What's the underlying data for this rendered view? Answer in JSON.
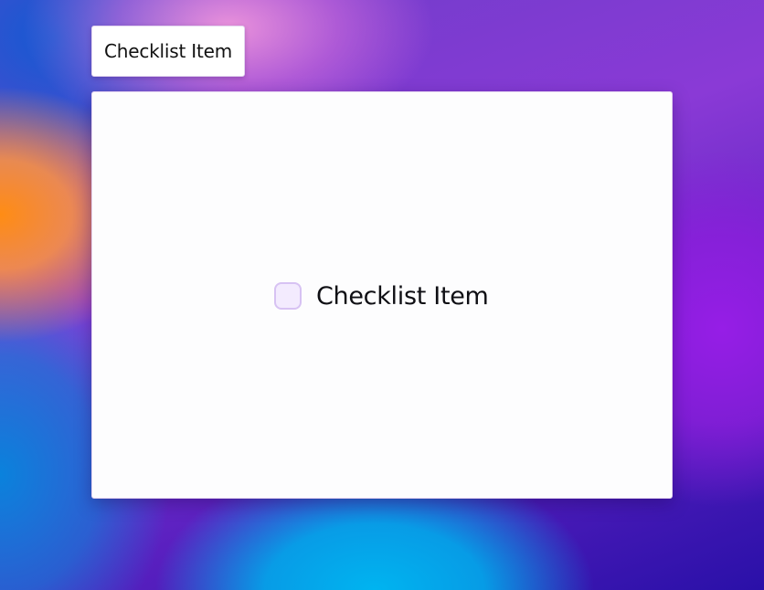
{
  "tag": {
    "label": "Checklist Item"
  },
  "panel": {
    "item": {
      "label": "Checklist Item",
      "checked": false
    }
  },
  "colors": {
    "checkbox_border": "#d7c2f3",
    "checkbox_fill": "#f3ebfe",
    "panel_background": "#fdfdfe"
  }
}
